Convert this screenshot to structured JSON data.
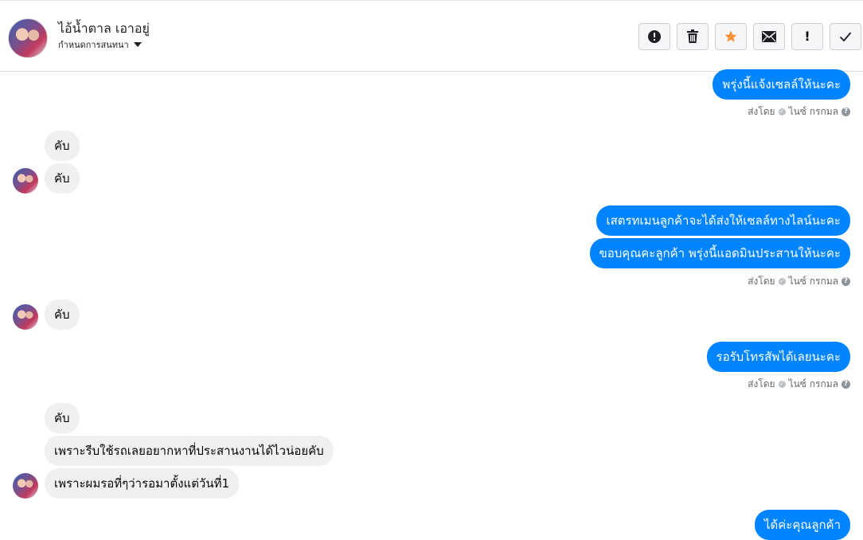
{
  "header": {
    "contact_name": "ไอ้น้ำตาล เอาอยู่",
    "conversation_settings": "กำหนดการสนทนา",
    "actions": [
      {
        "name": "report-button",
        "icon": "exclamation-circle-icon",
        "glyph": "!"
      },
      {
        "name": "delete-button",
        "icon": "trash-icon",
        "glyph": "🗑"
      },
      {
        "name": "star-button",
        "icon": "star-icon",
        "glyph": "★"
      },
      {
        "name": "mark-unread-button",
        "icon": "envelope-icon",
        "glyph": "✉"
      },
      {
        "name": "mark-spam-button",
        "icon": "exclamation-icon",
        "glyph": "!"
      },
      {
        "name": "mark-done-button",
        "icon": "check-icon",
        "glyph": "✓"
      }
    ]
  },
  "messages": [
    {
      "dir": "out",
      "text": "พรุ่งนี้แจ้งเซลล์ให้นะคะ"
    },
    {
      "dir": "in",
      "text": "คับ"
    },
    {
      "dir": "in",
      "text": "คับ"
    },
    {
      "dir": "out",
      "text": "เสตรทเมนลูกค้าจะได้ส่งให้เซลล์ทางไลน์นะคะ"
    },
    {
      "dir": "out",
      "text": "ขอบคุณคะลูกค้า พรุ่งนี้แอดมินประสานให้นะคะ"
    },
    {
      "dir": "in",
      "text": "คับ"
    },
    {
      "dir": "out",
      "text": "รอรับโทรสัพได้เลยนะคะ"
    },
    {
      "dir": "in",
      "text": "คับ"
    },
    {
      "dir": "in",
      "text": "เพราะรีบใช้รถเลยอยากหาที่ประสานงานได้ไวน่อยคับ"
    },
    {
      "dir": "in",
      "text": "เพราะผมรอที่ๆว่ารอมาตั้งแต่วันที่1"
    },
    {
      "dir": "out",
      "text": "ได้ค่ะคุณลูกค้า"
    }
  ],
  "sent_status": {
    "sent_by": "ส่งโดย",
    "sender": "ไนซ์ กรกมล"
  },
  "colors": {
    "outgoing": "#0084ff",
    "incoming": "#f0f0f0",
    "star": "#f7923a"
  }
}
